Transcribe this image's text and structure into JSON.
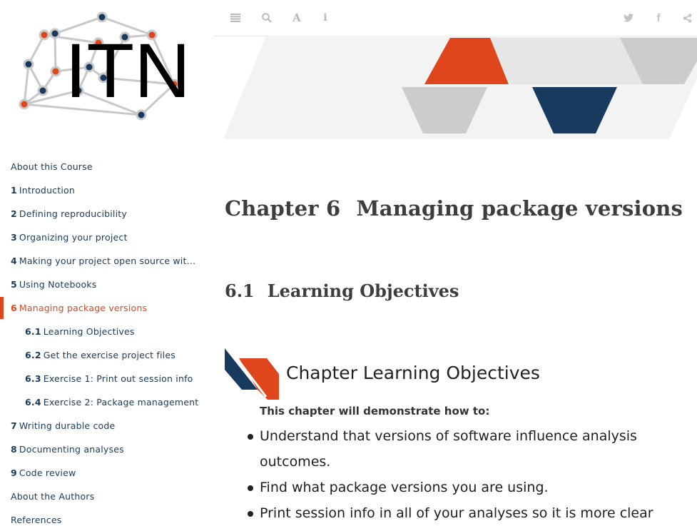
{
  "sidebar": {
    "logo_text": "ITN",
    "toc": [
      {
        "num": "",
        "label": "About this Course",
        "level": 0,
        "active": false
      },
      {
        "num": "1",
        "label": "Introduction",
        "level": 0,
        "active": false
      },
      {
        "num": "2",
        "label": "Defining reproducibility",
        "level": 0,
        "active": false
      },
      {
        "num": "3",
        "label": "Organizing your project",
        "level": 0,
        "active": false
      },
      {
        "num": "4",
        "label": "Making your project open source with …",
        "level": 0,
        "active": false
      },
      {
        "num": "5",
        "label": "Using Notebooks",
        "level": 0,
        "active": false
      },
      {
        "num": "6",
        "label": "Managing package versions",
        "level": 0,
        "active": true
      },
      {
        "num": "6.1",
        "label": "Learning Objectives",
        "level": 1,
        "active": false
      },
      {
        "num": "6.2",
        "label": "Get the exercise project files",
        "level": 1,
        "active": false
      },
      {
        "num": "6.3",
        "label": "Exercise 1: Print out session info",
        "level": 1,
        "active": false
      },
      {
        "num": "6.4",
        "label": "Exercise 2: Package management",
        "level": 1,
        "active": false
      },
      {
        "num": "7",
        "label": "Writing durable code",
        "level": 0,
        "active": false
      },
      {
        "num": "8",
        "label": "Documenting analyses",
        "level": 0,
        "active": false
      },
      {
        "num": "9",
        "label": "Code review",
        "level": 0,
        "active": false
      },
      {
        "num": "",
        "label": "About the Authors",
        "level": 0,
        "active": false
      },
      {
        "num": "",
        "label": "References",
        "level": 0,
        "active": false
      }
    ]
  },
  "toolbar": {
    "left": [
      {
        "name": "toggle-sidebar-icon",
        "glyph": "≣"
      },
      {
        "name": "search-icon",
        "glyph": "search"
      },
      {
        "name": "font-settings-icon",
        "glyph": "A"
      },
      {
        "name": "info-icon",
        "glyph": "i"
      }
    ],
    "right": [
      {
        "name": "twitter-icon",
        "glyph": "twitter"
      },
      {
        "name": "facebook-icon",
        "glyph": "f"
      },
      {
        "name": "share-icon",
        "glyph": "share"
      }
    ]
  },
  "colors": {
    "accent": "#e0461b",
    "navy": "#173a5e",
    "gray": "#cccccc",
    "light_gray": "#e6e6e6"
  },
  "main": {
    "chapter_num": "Chapter 6",
    "chapter_title": "Managing package versions",
    "section_num": "6.1",
    "section_title": "Learning Objectives",
    "objectives_title": "Chapter Learning Objectives",
    "objectives_intro": "This chapter will demonstrate how to:",
    "objectives": [
      "Understand that versions of software influence analysis outcomes.",
      "Find what package versions you are using.",
      "Print session info in all of your analyses so it is more clear"
    ]
  }
}
